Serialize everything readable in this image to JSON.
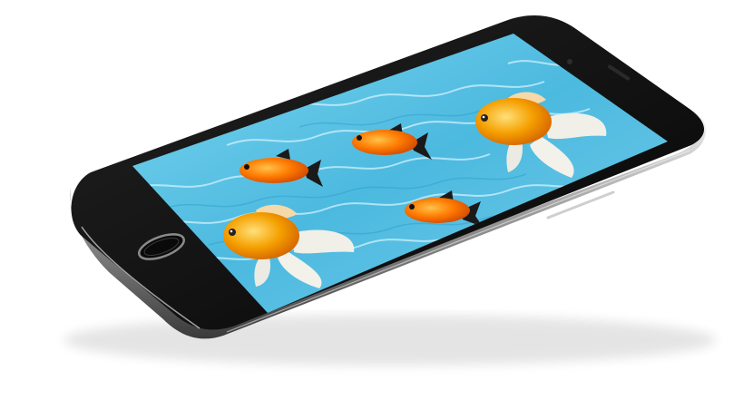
{
  "image": {
    "subject": "smartphone-product-photo",
    "background_color": "#ffffff",
    "device": {
      "body_color": "#111111",
      "frame_color": "#bdbdbd",
      "screen_wallpaper": "goldfish-swimming-in-pool-water",
      "water_color": "#5ec7e6",
      "fish_colors": [
        "#ff7a00",
        "#f5a000",
        "#f0efe8"
      ]
    }
  }
}
